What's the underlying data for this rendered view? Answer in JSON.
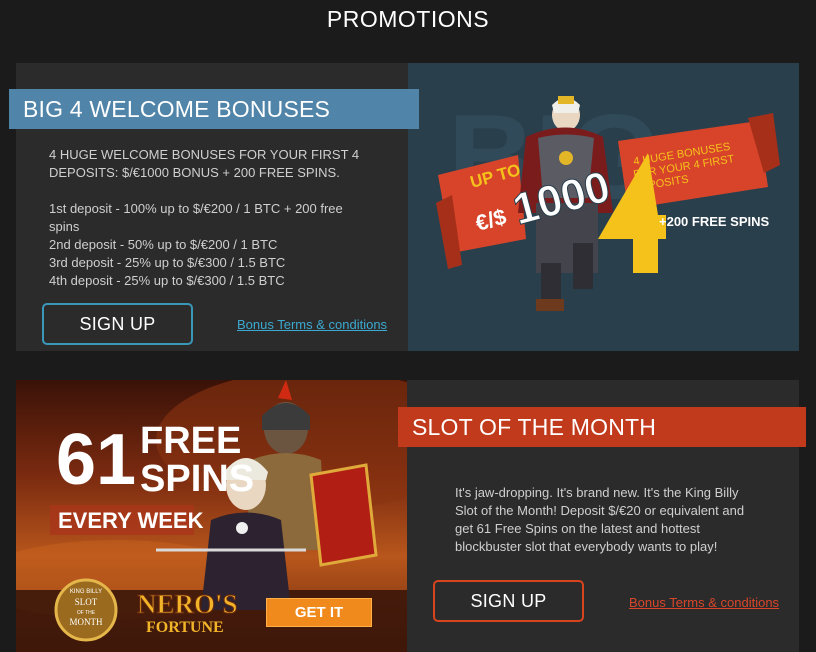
{
  "page": {
    "title": "PROMOTIONS"
  },
  "welcome": {
    "ribbon": "BIG 4 WELCOME BONUSES",
    "intro": "4 HUGE WELCOME BONUSES FOR YOUR FIRST 4 DEPOSITS: $/€1000 BONUS + 200 FREE SPINS.",
    "deposits": [
      "1st deposit - 100% up to $/€200 / 1 BTC + 200 free spins",
      "2nd deposit - 50% up to $/€200 / 1 BTC",
      "3rd deposit - 25% up to $/€300 / 1.5 BTC",
      "4th deposit - 25% up to $/€300 / 1.5 BTC"
    ],
    "signup_label": "SIGN UP",
    "terms_label": "Bonus Terms & conditions",
    "banner": {
      "up_to": "UP TO",
      "currency": "€/$",
      "amount": "1000",
      "big_number": "4",
      "tagline_lines": [
        "4 HUGE BONUSES",
        "FOR YOUR 4 FIRST",
        "DEPOSITS"
      ],
      "free_spins": "+200 FREE SPINS"
    }
  },
  "slot": {
    "ribbon": "SLOT OF THE MONTH",
    "description": "It's jaw-dropping. It's brand new. It's the King Billy Slot of the Month! Deposit $/€20 or equivalent and get 61 Free Spins on the latest and hottest blockbuster slot that everybody wants to play!",
    "signup_label": "SIGN UP",
    "terms_label": "Bonus Terms & conditions",
    "banner": {
      "count": "61",
      "free": "FREE",
      "spins": "SPINS",
      "every_week": "EVERY WEEK",
      "badge_lines": [
        "KING BILLY",
        "SLOT",
        "OF THE",
        "MONTH"
      ],
      "game_title_1": "NERO'S",
      "game_title_2": "FORTUNE",
      "get_it_label": "GET IT"
    }
  },
  "colors": {
    "background": "#1b1b1b",
    "card": "#2b2b2b",
    "blue_accent": "#5084a8",
    "red_accent": "#c23a1c",
    "link_blue": "#3ca9d1",
    "link_red": "#d8462a",
    "gold": "#f5c21b",
    "orange_button": "#f08a1c"
  }
}
